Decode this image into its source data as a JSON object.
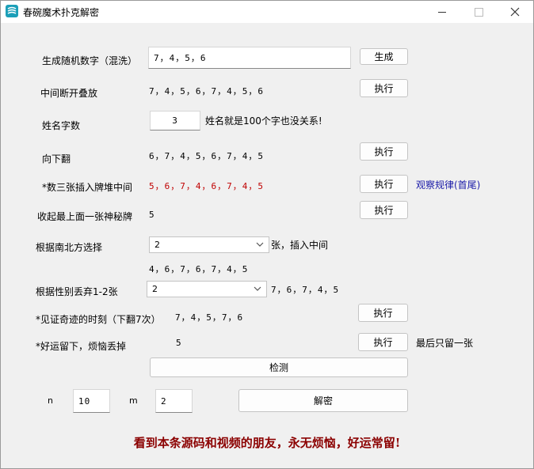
{
  "window": {
    "title": "春碗魔术扑克解密"
  },
  "rows": {
    "generate": {
      "label": "生成随机数字（混洗）",
      "value": "7，4，5，6",
      "button": "生成"
    },
    "middle_split": {
      "label": "中间断开叠放",
      "value": "7，4，5，6，7，4，5，6",
      "button": "执行"
    },
    "name_len": {
      "label": "姓名字数",
      "value": "3",
      "note": "姓名就是100个字也没关系!"
    },
    "flip_down": {
      "label": "向下翻",
      "value": "6，7，4，5，6，7，4，5",
      "button": "执行"
    },
    "insert_three": {
      "label": "*数三张插入牌堆中间",
      "value": "5，6，7，4，6，7，4，5",
      "button": "执行",
      "link": "观察规律(首尾)"
    },
    "hide_top": {
      "label": "收起最上面一张神秘牌",
      "value": "5",
      "button": "执行"
    },
    "direction": {
      "label": "根据南北方选择",
      "selected": "2",
      "suffix": "张，插入中间",
      "value": "4，6，7，6，7，4，5"
    },
    "gender": {
      "label": "根据性别丢弃1-2张",
      "selected": "2",
      "value": "7，6，7，4，5"
    },
    "miracle": {
      "label": "*见证奇迹的时刻（下翻7次）",
      "value": "7，4，5，7，6",
      "button": "执行"
    },
    "good_luck": {
      "label": "*好运留下，烦恼丢掉",
      "value": "5",
      "button": "执行",
      "note": "最后只留一张"
    }
  },
  "detect_button": "检测",
  "params": {
    "n_label": "n",
    "n_value": "10",
    "m_label": "m",
    "m_value": "2",
    "decrypt_button": "解密"
  },
  "footer": "看到本条源码和视频的朋友，永无烦恼，好运常留!"
}
